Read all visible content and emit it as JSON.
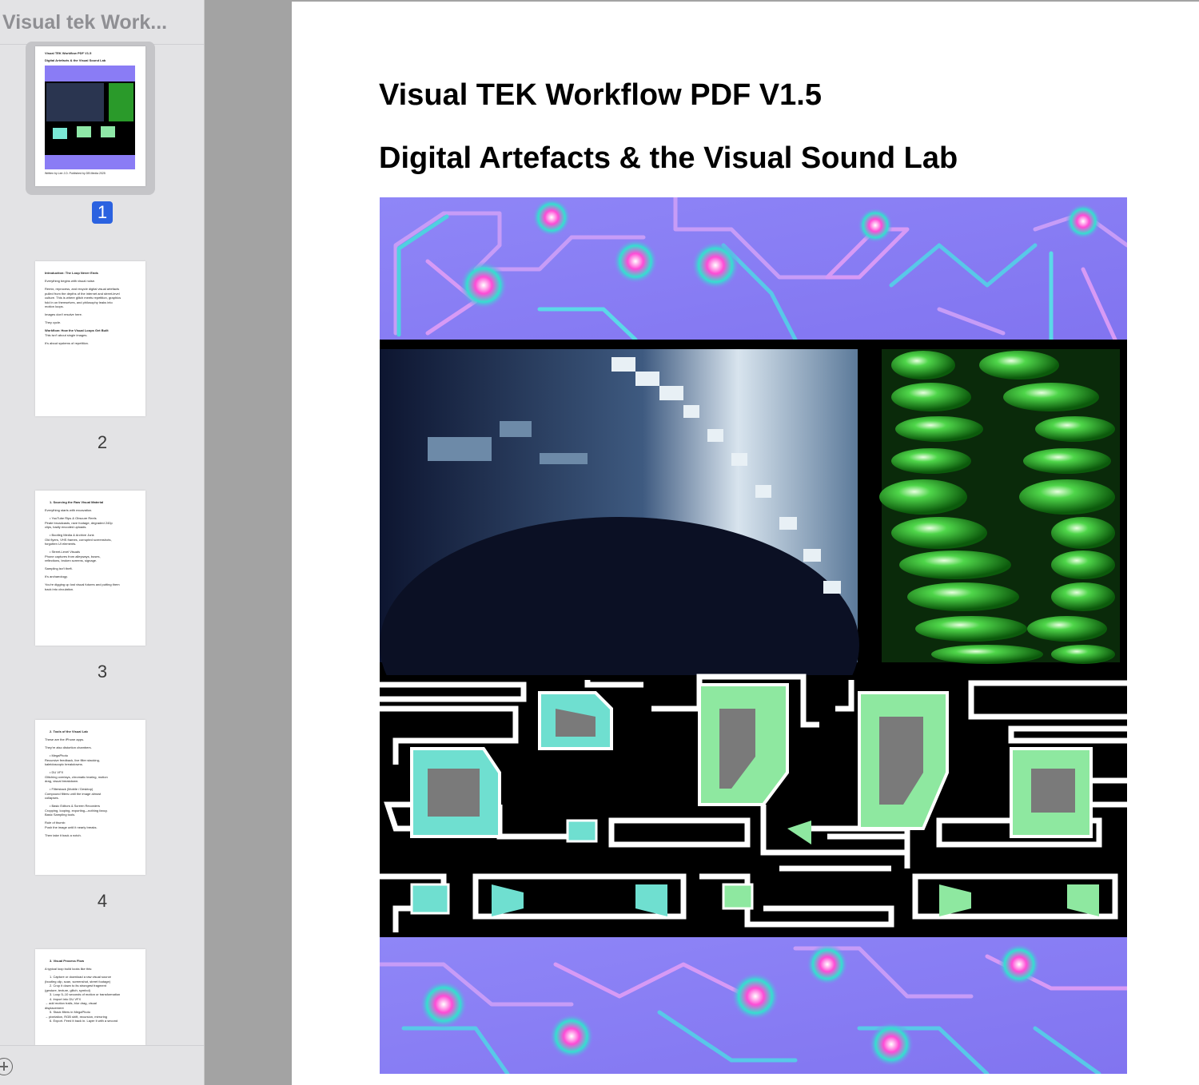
{
  "window": {
    "sidebar_title": "Visual tek Work..."
  },
  "thumbnails": [
    {
      "page_number": "1",
      "selected": true,
      "lines": [
        "Visual TEK Workflow PDF V1.5",
        "Digital Artefacts & the Visual Sound Lab"
      ],
      "footer": "Written by Lee J.D. Published by DB Media 2025"
    },
    {
      "page_number": "2",
      "selected": false,
      "lines": [
        "Introduction: The Loop Never Ends",
        "Everything begins with visual noise.",
        "Remix, reprocess, and recycle digital visual artefacts",
        "pulled from the depths of the internet and street-level",
        "culture. This is where glitch meets repetition, graphics",
        "fold in on themselves, and philosophy leaks into",
        "motion loops.",
        "Images don't resolve here.",
        "They cycle.",
        "Workflow: How the Visual Loops Get Built",
        "This isn't about single images.",
        "It's about systems of repetition."
      ]
    },
    {
      "page_number": "3",
      "selected": false,
      "lines": [
        "1. Sourcing the Raw Visual Material",
        "Everything starts with excavation.",
        "• YouTube Rips & Obscure Reels",
        "Pirate broadcasts, rave footage, degraded 240p",
        "clips, badly encoded uploads.",
        "• Bootleg Media & Archive Junk",
        "Old flyers, VHS frames, corrupted screenshots,",
        "forgotten UI elements.",
        "• Street-Level Visuals",
        "Phone captures from alleyways, buses,",
        "reflections, broken screens, signage.",
        "Sampling isn't theft.",
        "It's archaeology.",
        "You're digging up lost visual futures and putting them",
        "back into circulation."
      ]
    },
    {
      "page_number": "4",
      "selected": false,
      "lines": [
        "2. Tools of the Visual Lab",
        "These are the iPhone apps.",
        "They're also distortion chambers.",
        "• MegaPhoto",
        "Recursive feedback, live filter stacking,",
        "kaleidoscopic breakdowns.",
        "• DU VFX",
        "Glitching overlays, chromatic tearing, motion",
        "drag, visual breakdown.",
        "• Filterstack (Mobile / Desktop)",
        "Compound filters until the image almost",
        "collapses.",
        "• Basic Editors & Screen Recorders",
        "Cropping, looping, exporting—nothing fancy.",
        "Basic Sampling tools.",
        "Rule of thumb:",
        "Push the image until it nearly breaks.",
        "Then take it back a notch."
      ]
    },
    {
      "page_number": "5",
      "selected": false,
      "lines": [
        "3. Visual Process Flow",
        "A typical loop build looks like this:",
        "1. Capture or download a raw visual source",
        "(bootleg clip, scan, screenshot, street footage)",
        "2. Crop it down to its strongest fragment",
        "(gesture, texture, glitch, symbol)",
        "3. Loop 5–10 seconds of motion or transformation",
        "4. Import into DU VFX",
        "→ add motion trails, blur drag, visual",
        "displacement",
        "5. Stack filters in MegaPhoto",
        "→ pixelation, RGB shift, recursion, mirroring",
        "6. Export. Feed it back in. Layer it with a second"
      ]
    }
  ],
  "document": {
    "title": "Visual TEK Workflow PDF V1.5",
    "subtitle": "Digital Artefacts & the Visual Sound Lab"
  },
  "colors": {
    "accent": "#2b62e0",
    "normal_map_purple": "#8a7cf5",
    "glitch_green": "#2fbf2f",
    "cyan_block": "#7ae8d6",
    "gray_block": "#7a7a7a"
  }
}
